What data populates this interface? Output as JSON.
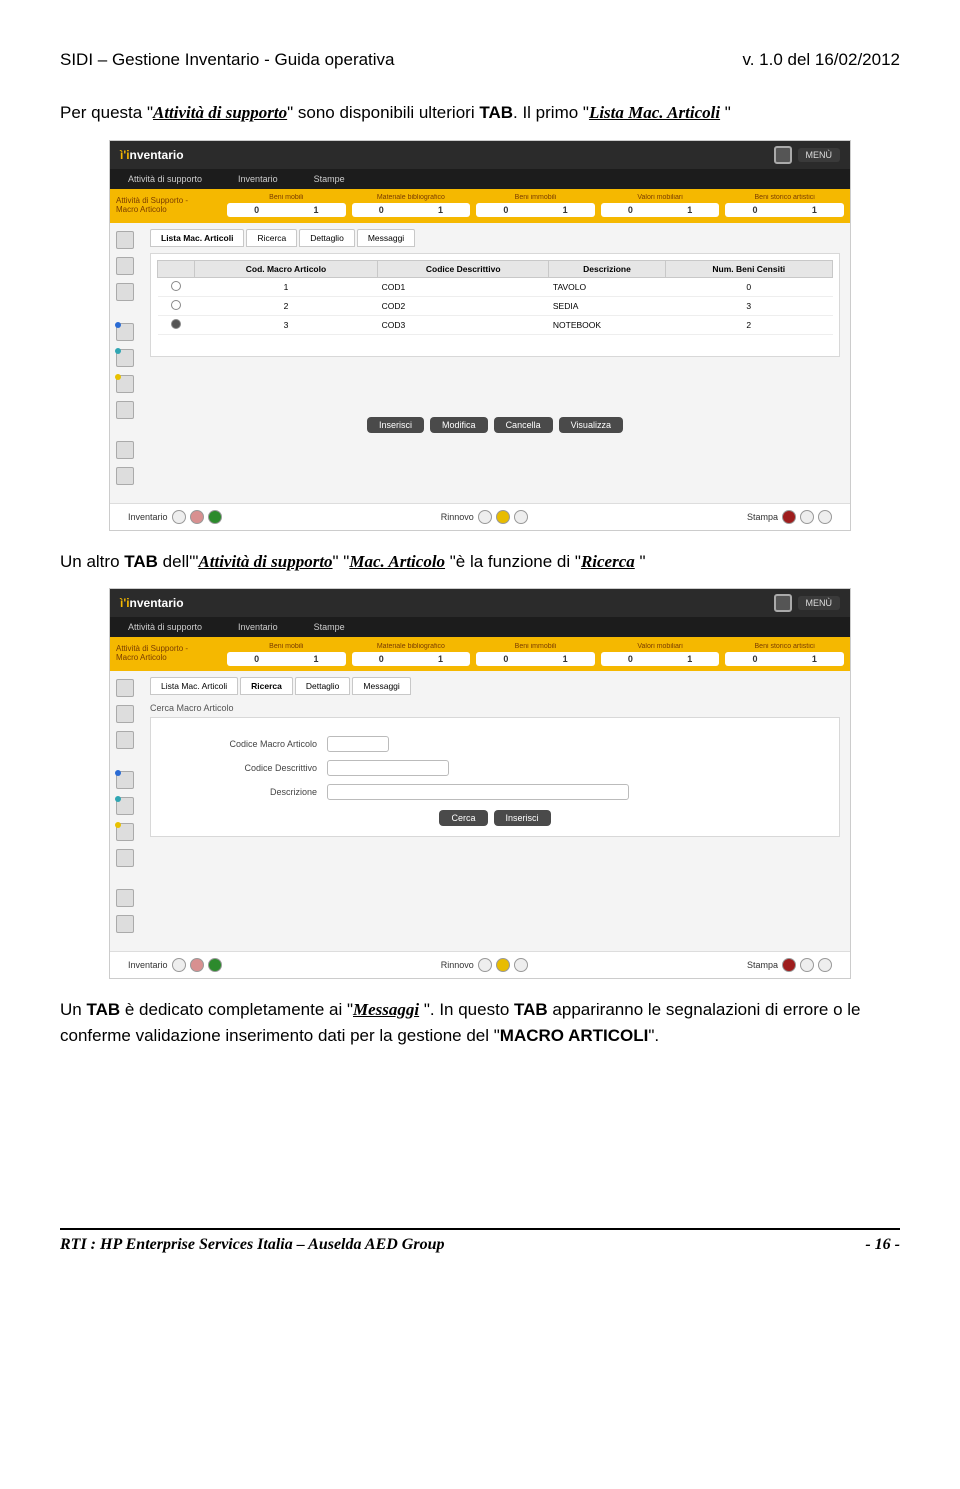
{
  "header": {
    "left": "SIDI – Gestione Inventario - Guida operativa",
    "right": "v. 1.0 del 16/02/2012"
  },
  "p1": {
    "a": "Per questa \"",
    "link1": "Attività di supporto",
    "b": "\" sono disponibili ulteriori ",
    "tab": "TAB",
    "c": ". Il primo \"",
    "link2": "Lista Mac. Articoli",
    "d": " \""
  },
  "p2": {
    "a": "Un altro ",
    "tab": "TAB",
    "b": " dell'\"",
    "link1": "Attività di supporto",
    "c": "\" \"",
    "link2": "Mac. Articolo",
    "d": " \"è la funzione di \"",
    "link3": "Ricerca",
    "e": " \""
  },
  "p3": {
    "a": "Un ",
    "tab1": "TAB",
    "b": " è dedicato completamente ai \"",
    "link": "Messaggi",
    "c": " \". In questo ",
    "tab2": "TAB",
    "d": " appariranno le segnalazioni di errore o le conferme validazione inserimento dati per la gestione del \"",
    "macro": "MACRO ARTICOLI",
    "e": "\"."
  },
  "app": {
    "brand_pre": "ì'i",
    "brand": "nventario",
    "menu": "MENÙ",
    "nav": [
      "Attività di supporto",
      "Inventario",
      "Stampe"
    ],
    "breadcrumb": "Attività di Supporto -\nMacro Articolo",
    "sum_cats": [
      "Beni mobili",
      "Materiale bibliografico",
      "Beni immobili",
      "Valori mobiliari",
      "Beni storico artistici"
    ],
    "sum_vals": [
      [
        "0",
        "1"
      ],
      [
        "0",
        "1"
      ],
      [
        "0",
        "1"
      ],
      [
        "0",
        "1"
      ],
      [
        "0",
        "1"
      ]
    ],
    "tabs1": [
      "Lista Mac. Articoli",
      "Ricerca",
      "Dettaglio",
      "Messaggi"
    ],
    "th": [
      "",
      "Cod. Macro Articolo",
      "Codice Descrittivo",
      "Descrizione",
      "Num. Beni Censiti"
    ],
    "rows": [
      {
        "sel": false,
        "id": "1",
        "cod": "COD1",
        "desc": "TAVOLO",
        "n": "0"
      },
      {
        "sel": false,
        "id": "2",
        "cod": "COD2",
        "desc": "SEDIA",
        "n": "3"
      },
      {
        "sel": true,
        "id": "3",
        "cod": "COD3",
        "desc": "NOTEBOOK",
        "n": "2"
      }
    ],
    "btns": [
      "Inserisci",
      "Modifica",
      "Cancella",
      "Visualizza"
    ],
    "foot": [
      "Inventario",
      "Rinnovo",
      "Stampa"
    ],
    "tabs2": [
      "Lista Mac. Articoli",
      "Ricerca",
      "Dettaglio",
      "Messaggi"
    ],
    "search_title": "Cerca Macro Articolo",
    "f1": "Codice Macro Articolo",
    "f2": "Codice Descrittivo",
    "f3": "Descrizione",
    "btns2": [
      "Cerca",
      "Inserisci"
    ]
  },
  "footer": {
    "left": "RTI : HP Enterprise Services Italia – Auselda AED Group",
    "right": "- 16 -"
  }
}
